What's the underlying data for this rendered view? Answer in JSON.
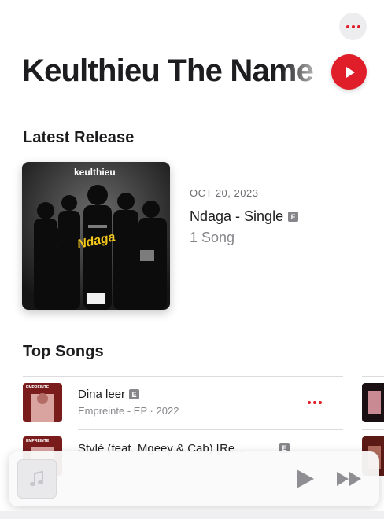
{
  "header": {
    "artist_name": "Keulthieu The Name",
    "more_icon": "ellipsis-icon",
    "play_icon": "play-icon"
  },
  "latest_release": {
    "section_title": "Latest Release",
    "artwork_text": "keulthieu",
    "artwork_script": "Ndaga",
    "date": "OCT 20, 2023",
    "title": "Ndaga - Single",
    "explicit_badge": "E",
    "song_count": "1 Song"
  },
  "top_songs": {
    "section_title": "Top Songs",
    "songs": [
      {
        "title": "Dina leer",
        "explicit_badge": "E",
        "album": "Empreinte - EP",
        "separator": "·",
        "year": "2022",
        "thumb_label": "EMPREINTE"
      },
      {
        "title": "Stylé (feat. Mgeey & Cab) [Re…",
        "explicit_badge": "E",
        "thumb_label": "EMPREINTE"
      }
    ]
  },
  "player": {
    "artwork_icon": "music-note-icon",
    "play_icon": "play-icon",
    "next_icon": "fast-forward-icon"
  },
  "colors": {
    "accent": "#e01e2a",
    "text_primary": "#1d1d1f",
    "text_secondary": "#86868b",
    "badge_gray": "#86868b"
  }
}
